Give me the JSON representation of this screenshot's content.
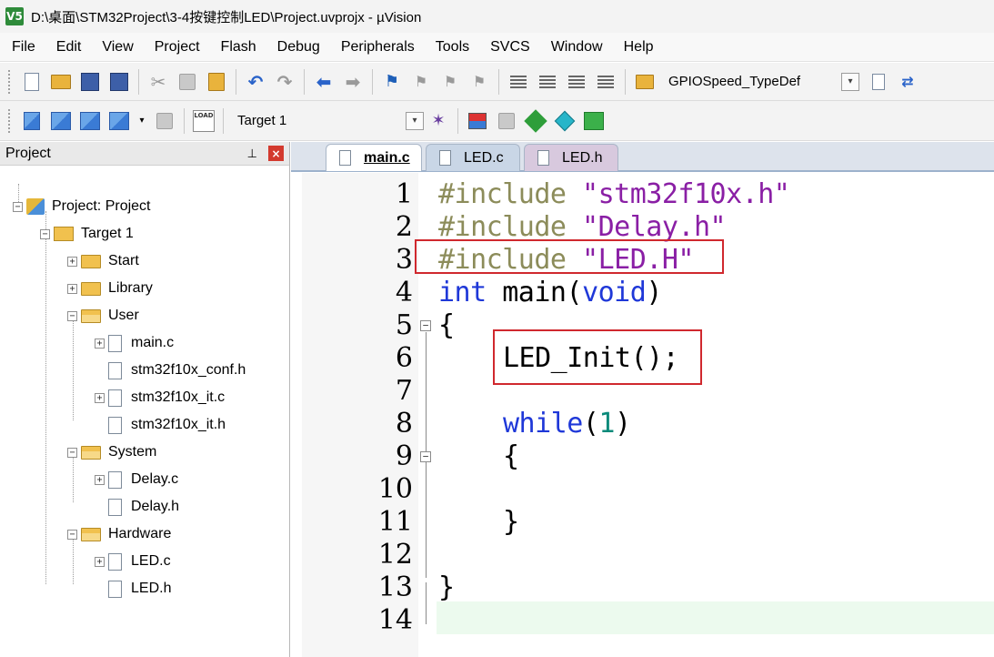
{
  "window": {
    "title": "D:\\桌面\\STM32Project\\3-4按键控制LED\\Project.uvprojx - µVision",
    "app_icon": "V5"
  },
  "menu": [
    "File",
    "Edit",
    "View",
    "Project",
    "Flash",
    "Debug",
    "Peripherals",
    "Tools",
    "SVCS",
    "Window",
    "Help"
  ],
  "toolbar1": {
    "combo_value": "GPIOSpeed_TypeDef",
    "icons": [
      "new-file-icon",
      "open-folder-icon",
      "save-icon",
      "save-all-icon",
      "cut-icon",
      "copy-icon",
      "paste-icon",
      "undo-icon",
      "redo-icon",
      "nav-back-icon",
      "nav-forward-icon",
      "bookmark-icon",
      "prev-bookmark-icon",
      "next-bookmark-icon",
      "clear-bookmarks-icon",
      "indent-icon",
      "unindent-icon",
      "comment-icon",
      "uncomment-icon",
      "find-in-files-icon",
      "dropdown-icon",
      "find-icon",
      "debug-icon"
    ]
  },
  "toolbar2": {
    "target_value": "Target 1",
    "load_label": "LOAD",
    "icons": [
      "translate-icon",
      "build-icon",
      "rebuild-icon",
      "batch-build-icon",
      "stop-build-icon",
      "download-icon",
      "target-options-icon",
      "file-extensions-icon",
      "manage-components-icon",
      "pack-installer-icon",
      "select-packs-icon",
      "green-gem-icon"
    ]
  },
  "project_panel": {
    "title": "Project",
    "pin_glyph": "⊥",
    "close_glyph": "×",
    "tree": {
      "root": "Project: Project",
      "target": "Target 1",
      "groups": [
        {
          "name": "Start",
          "files": []
        },
        {
          "name": "Library",
          "files": []
        },
        {
          "name": "User",
          "files": [
            "main.c",
            "stm32f10x_conf.h",
            "stm32f10x_it.c",
            "stm32f10x_it.h"
          ]
        },
        {
          "name": "System",
          "files": [
            "Delay.c",
            "Delay.h"
          ]
        },
        {
          "name": "Hardware",
          "files": [
            "LED.c",
            "LED.h"
          ]
        }
      ]
    }
  },
  "tabs": [
    "main.c",
    "LED.c",
    "LED.h"
  ],
  "active_tab": "main.c",
  "editor": {
    "line_numbers": [
      "1",
      "2",
      "3",
      "4",
      "5",
      "6",
      "7",
      "8",
      "9",
      "10",
      "11",
      "12",
      "13",
      "14"
    ],
    "lines": {
      "l1_pp": "#include",
      "l1_str": " \"stm32f10x.h\"",
      "l2_pp": "#include",
      "l2_str": " \"Delay.h\"",
      "l3_pp": "#include",
      "l3_str": " \"LED.H\"",
      "l4_kw1": "int",
      "l4_mid": " main(",
      "l4_kw2": "void",
      "l4_end": ")",
      "l5": "{",
      "l6": "LED_Init();",
      "l8_kw": "while",
      "l8_open": "(",
      "l8_num": "1",
      "l8_close": ")",
      "l9": "{",
      "l11": "}",
      "l13": "}"
    },
    "highlight_color": "#d0282e"
  }
}
